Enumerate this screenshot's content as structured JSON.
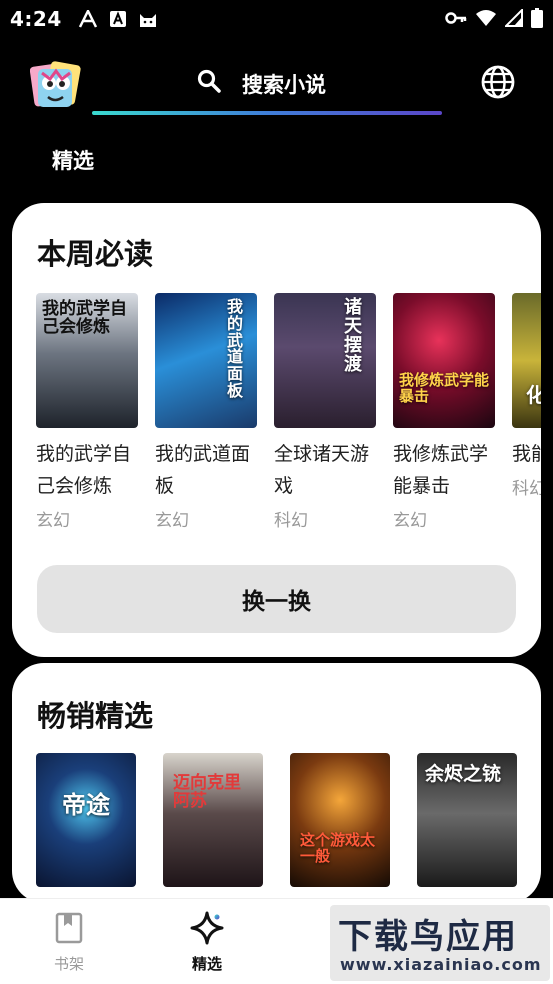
{
  "status_bar": {
    "time": "4:24",
    "left_icons": [
      "accessibility-a-icon",
      "a-box-icon",
      "cat-icon"
    ],
    "right_icons": [
      "key-icon",
      "wifi-icon",
      "signal-icon",
      "battery-icon"
    ]
  },
  "header": {
    "search_label": "搜索小说",
    "logo_icon": "app-logo-icon",
    "globe_icon": "globe-icon"
  },
  "channel_tab": "精选",
  "weekly": {
    "title": "本周必读",
    "books": [
      {
        "title": "我的武学自己会修炼",
        "genre": "玄幻",
        "cover_text": "我的武学自己会修炼"
      },
      {
        "title": "我的武道面板",
        "genre": "玄幻",
        "cover_text": "我的武道面板"
      },
      {
        "title": "全球诸天游戏",
        "genre": "科幻",
        "cover_text": "诸天摆渡"
      },
      {
        "title": "我修炼武学能暴击",
        "genre": "玄幻",
        "cover_text": "我修炼武学能暴击"
      },
      {
        "title": "我能万物",
        "genre": "科幻",
        "cover_text": "化"
      }
    ],
    "swap_label": "换一换"
  },
  "bestsell": {
    "title": "畅销精选",
    "covers": [
      "帝途",
      "迈向克里阿苏",
      "这个游戏太一般",
      "余烬之铳"
    ]
  },
  "bottom_nav": {
    "items": [
      {
        "label": "书架",
        "icon": "bookmark-book-icon"
      },
      {
        "label": "精选",
        "icon": "sparkle-star-icon"
      }
    ]
  },
  "watermark": {
    "text": "下载鸟应用",
    "url": "www.xiazainiao.com"
  }
}
